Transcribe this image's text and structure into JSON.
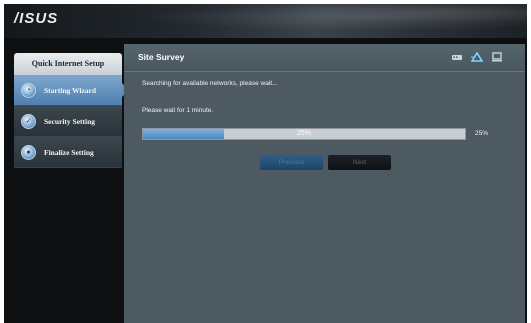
{
  "brand": {
    "logo_text": "/ISUS"
  },
  "sidebar": {
    "title": "Quick Internet Setup",
    "items": [
      {
        "label": "Starting Wizard",
        "active": true
      },
      {
        "label": "Security Setting",
        "active": false
      },
      {
        "label": "Finalize Setting",
        "active": false
      }
    ]
  },
  "main": {
    "title": "Site Survey",
    "status_text": "Searching for available networks, please wait...",
    "wait_text": "Please wait for 1 minute.",
    "progress": {
      "value": 25,
      "label": "25%",
      "side_label": "25%"
    },
    "buttons": {
      "previous": "Previous",
      "next": "Next"
    },
    "header_icons": [
      "router-icon",
      "wifi-icon",
      "computer-icon"
    ]
  },
  "colors": {
    "accent": "#5e8dba",
    "panel": "#4d5a62",
    "progress_fill": "#4d86bd"
  }
}
